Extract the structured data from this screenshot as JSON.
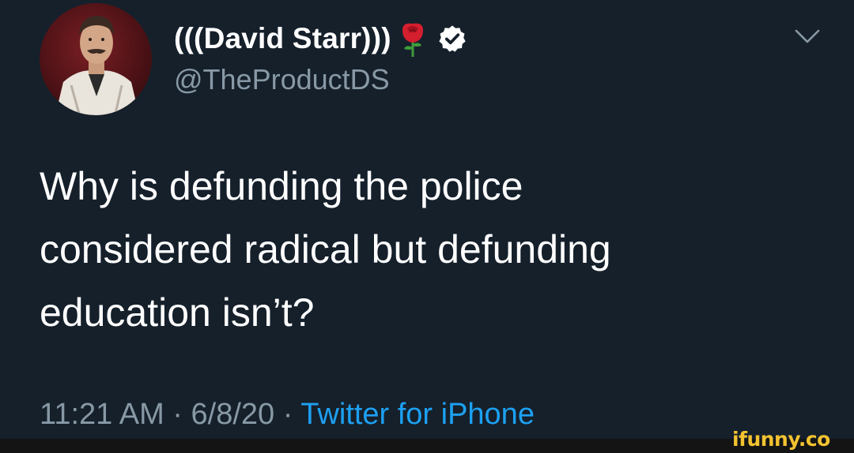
{
  "tweet": {
    "display_name": "(((David Starr)))",
    "handle": "@TheProductDS",
    "text_lines": [
      "Why is defunding the police",
      "considered radical but defunding",
      "education isn’t?"
    ],
    "time": "11:21 AM",
    "separator": "·",
    "date": "6/8/20",
    "source": "Twitter for iPhone",
    "icons": {
      "avatar": "profile-photo",
      "name_emoji": "rose-icon",
      "badge": "verified-badge-icon",
      "menu": "chevron-down-icon"
    }
  },
  "watermark": {
    "text": "ifunny.co"
  },
  "colors": {
    "background": "#15202b",
    "primary_text": "#ffffff",
    "secondary_text": "#8899a6",
    "link": "#1da1f2",
    "watermark": "#f2c230"
  }
}
